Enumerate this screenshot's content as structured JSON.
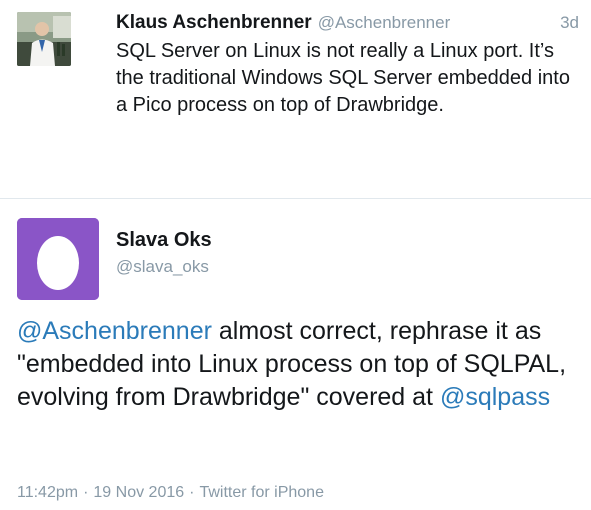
{
  "parent_tweet": {
    "author_name": "Klaus Aschenbrenner",
    "author_handle": "@Aschenbrenner",
    "time_ago": "3d",
    "text": "SQL Server on Linux is not really a Linux port. It’s the traditional Windows SQL Server embedded into a Pico process on top of Drawbridge."
  },
  "main_tweet": {
    "author_name": "Slava Oks",
    "author_handle": "@slava_oks",
    "text_parts": {
      "mention_1": "@Aschenbrenner",
      "text_1": " almost correct, rephrase it as \"embedded into Linux process on top of SQLPAL, evolving from Drawbridge\" covered at ",
      "mention_2": "@sqlpass"
    },
    "time": "11:42pm",
    "separator_1": "·",
    "date": "19 Nov 2016",
    "separator_2": "·",
    "source": "Twitter for iPhone"
  },
  "colors": {
    "link": "#2b7bb9",
    "secondary_text": "#8899a6",
    "primary_text": "#14171a",
    "default_avatar_bg": "#8a55c7",
    "divider": "#e1e8ed"
  },
  "icons": {
    "parent_avatar": "user-photo",
    "main_avatar": "default-egg-avatar"
  }
}
